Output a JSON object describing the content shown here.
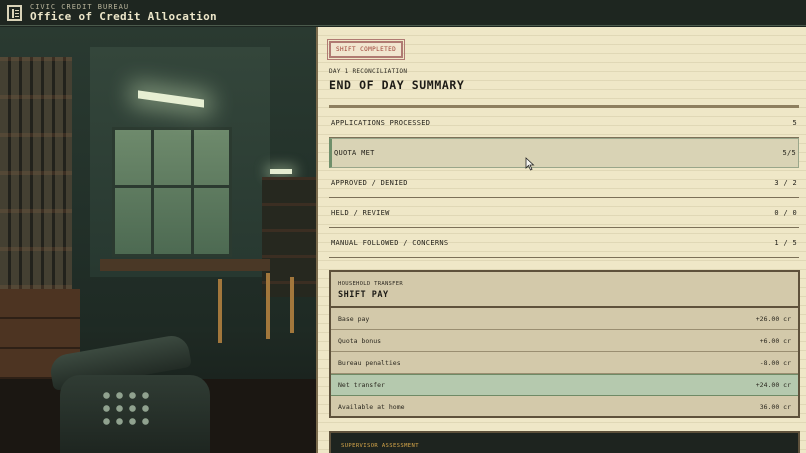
{
  "header": {
    "org": "CIVIC CREDIT BUREAU",
    "office": "Office of Credit Allocation",
    "logo_icon": "ledger-icon"
  },
  "summary": {
    "badge": "SHIFT COMPLETED",
    "kicker": "DAY 1 RECONCILIATION",
    "title": "END OF DAY SUMMARY",
    "stats": [
      {
        "label": "APPLICATIONS PROCESSED",
        "value": "5"
      },
      {
        "label": "QUOTA MET",
        "value": "5/5"
      },
      {
        "label": "APPROVED / DENIED",
        "value": "3 / 2"
      },
      {
        "label": "HELD / REVIEW",
        "value": "0 / 0"
      },
      {
        "label": "MANUAL FOLLOWED / CONCERNS",
        "value": "1 / 5"
      }
    ]
  },
  "pay": {
    "kicker": "HOUSEHOLD TRANSFER",
    "title": "SHIFT PAY",
    "rows": [
      {
        "label": "Base pay",
        "value": "+26.00 cr"
      },
      {
        "label": "Quota bonus",
        "value": "+6.00 cr"
      },
      {
        "label": "Bureau penalties",
        "value": "-8.00 cr"
      },
      {
        "label": "Net transfer",
        "value": "+24.00 cr"
      },
      {
        "label": "Available at home",
        "value": "36.00 cr"
      }
    ]
  },
  "assessment": {
    "label": "SUPERVISOR ASSESSMENT"
  },
  "colors": {
    "paper": "#efe7c7",
    "highlight_green": "#b5c9ae",
    "stamp_red": "#9b3d33",
    "accent_gold": "#d6a64a"
  }
}
